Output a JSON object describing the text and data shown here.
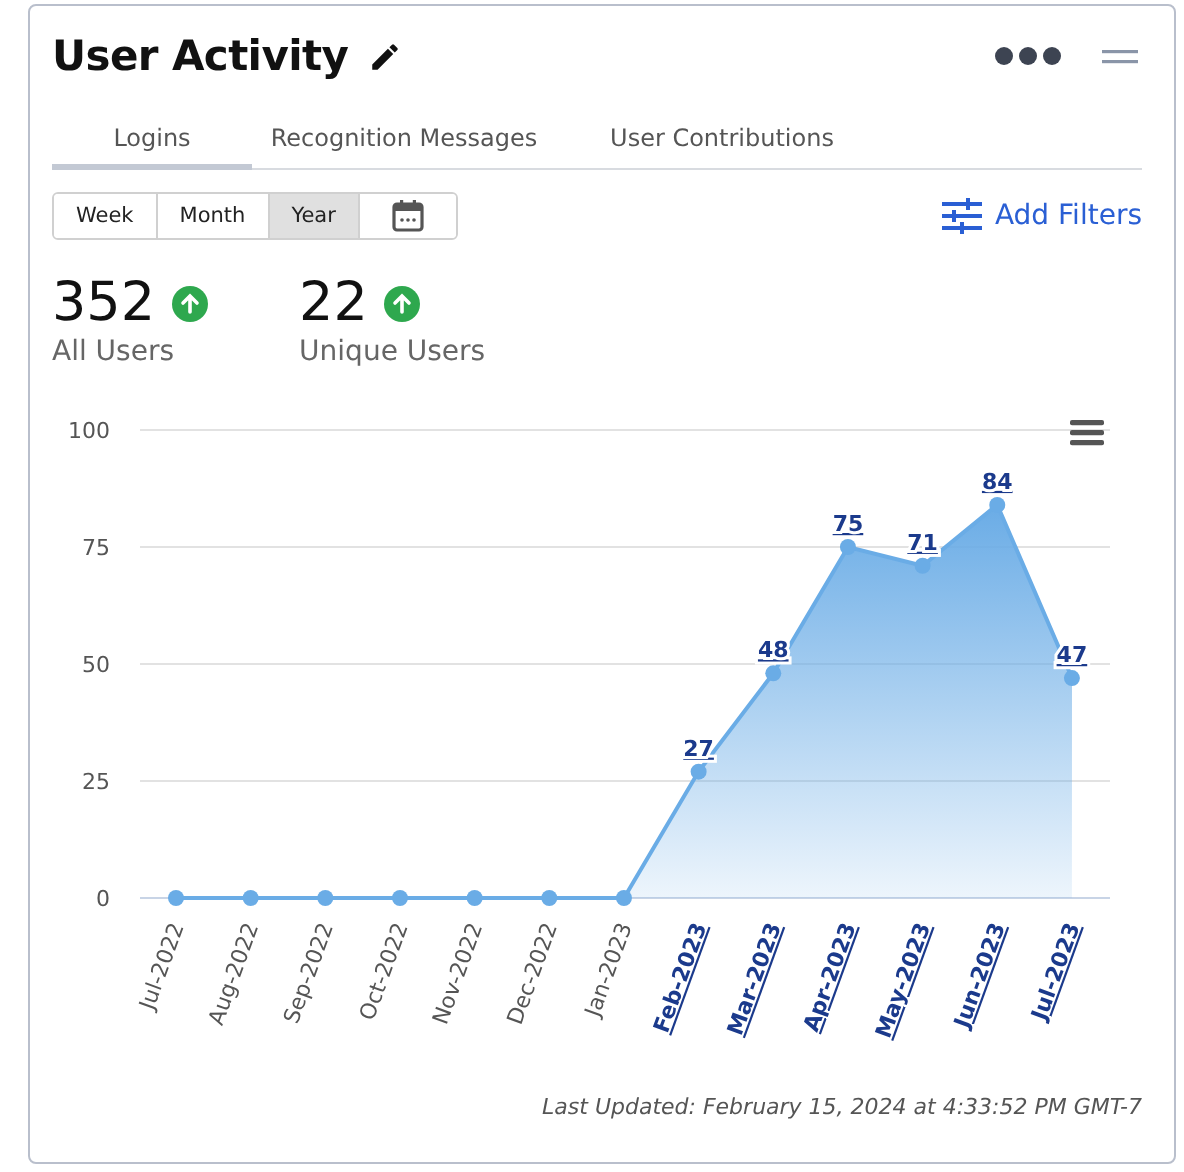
{
  "title": "User Activity",
  "tabs": [
    {
      "label": "Logins",
      "selected": true
    },
    {
      "label": "Recognition Messages",
      "selected": false
    },
    {
      "label": "User Contributions",
      "selected": false
    }
  ],
  "periods": [
    {
      "label": "Week",
      "selected": false
    },
    {
      "label": "Month",
      "selected": false
    },
    {
      "label": "Year",
      "selected": true
    }
  ],
  "filters_link": "Add Filters",
  "stats": [
    {
      "value": "352",
      "label": "All Users"
    },
    {
      "value": "22",
      "label": "Unique Users"
    }
  ],
  "chart_data": {
    "type": "area",
    "categories": [
      "Jul-2022",
      "Aug-2022",
      "Sep-2022",
      "Oct-2022",
      "Nov-2022",
      "Dec-2022",
      "Jan-2023",
      "Feb-2023",
      "Mar-2023",
      "Apr-2023",
      "May-2023",
      "Jun-2023",
      "Jul-2023"
    ],
    "series": [
      {
        "color": "#6aace6",
        "values": [
          0,
          0,
          0,
          0,
          0,
          0,
          0,
          27,
          48,
          75,
          71,
          84,
          47
        ]
      }
    ],
    "ylim": [
      0,
      100
    ],
    "yticks": [
      0,
      25,
      50,
      75,
      100
    ],
    "grid": true,
    "value_labels": [
      null,
      null,
      null,
      null,
      null,
      null,
      null,
      "27",
      "48",
      "75",
      "71",
      "84",
      "47"
    ]
  },
  "footer": "Last Updated: February 15, 2024 at 4:33:52 PM GMT-7"
}
